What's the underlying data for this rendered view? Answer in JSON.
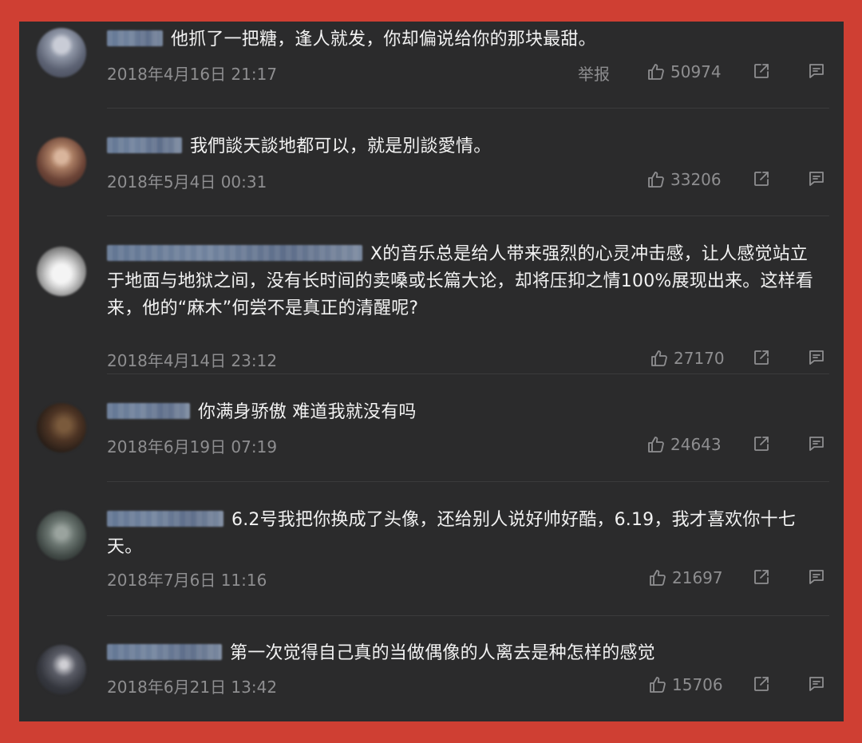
{
  "comments": [
    {
      "text": "他抓了一把糖，逢人就发，你却偏说给你的那块最甜。",
      "date": "2018年4月16日 21:17",
      "report": "举报",
      "likes": "50974",
      "avatar_color": "#6f7789"
    },
    {
      "text": "我們談天談地都可以，就是別談愛情。",
      "date": "2018年5月4日 00:31",
      "likes": "33206",
      "avatar_color": "#7a5648"
    },
    {
      "text": "X的音乐总是给人带来强烈的心灵冲击感，让人感觉站立于地面与地狱之间，没有长时间的卖嗓或长篇大论，却将压抑之情100%展现出来。这样看来，他的“麻木”何尝不是真正的清醒呢?",
      "date": "2018年4月14日 23:12",
      "likes": "27170",
      "avatar_color": "#d8d8d8"
    },
    {
      "text": "你满身骄傲 难道我就没有吗",
      "date": "2018年6月19日 07:19",
      "likes": "24643",
      "avatar_color": "#4a3528"
    },
    {
      "text": "6.2号我把你换成了头像，还给别人说好帅好酷，6.19，我才喜欢你十七天。",
      "date": "2018年7月6日 11:16",
      "likes": "21697",
      "avatar_color": "#5b6460"
    },
    {
      "text": "第一次觉得自己真的当做偶像的人离去是种怎样的感觉",
      "date": "2018年6月21日 13:42",
      "likes": "15706",
      "avatar_color": "#3a3c44"
    }
  ],
  "colors": {
    "frame": "#cf3f33",
    "panel": "#2b2b2c",
    "text": "#f2f2f2",
    "meta": "#8e8e90"
  }
}
